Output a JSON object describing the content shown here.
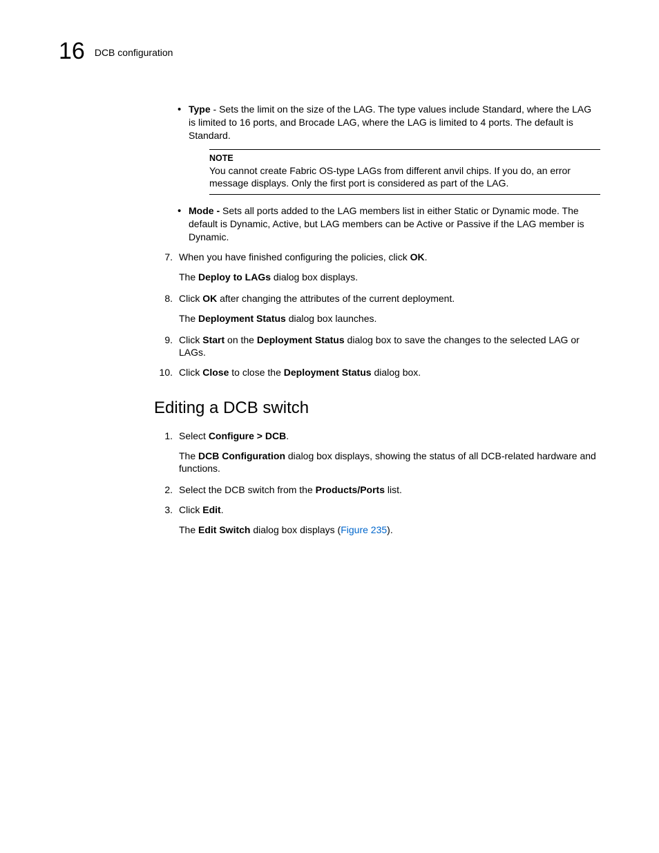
{
  "header": {
    "chapter_number": "16",
    "section_title": "DCB configuration"
  },
  "bullets": {
    "type": {
      "label": "Type",
      "text": " - Sets the limit on the size of the LAG. The type values include Standard, where the LAG is limited to 16 ports, and Brocade LAG, where the LAG is limited to 4 ports. The default is Standard."
    },
    "note": {
      "label": "NOTE",
      "text": "You cannot create Fabric OS-type LAGs from different anvil chips. If you do, an error message displays. Only the first port is considered as part of the LAG."
    },
    "mode": {
      "label": "Mode - ",
      "text": "Sets all ports added to the LAG members list in either Static or Dynamic mode. The default is Dynamic, Active, but LAG members can be Active or Passive if the LAG member is Dynamic."
    }
  },
  "steps_a": {
    "s7": {
      "num": "7.",
      "pre": "When you have finished configuring the policies, click ",
      "bold": "OK",
      "post": ".",
      "sub_pre": "The ",
      "sub_bold": "Deploy to LAGs",
      "sub_post": " dialog box displays."
    },
    "s8": {
      "num": "8.",
      "pre": "Click ",
      "bold": "OK",
      "post": " after changing the attributes of the current deployment.",
      "sub_pre": "The ",
      "sub_bold": "Deployment Status",
      "sub_post": " dialog box launches."
    },
    "s9": {
      "num": "9.",
      "pre": "Click ",
      "bold1": "Start",
      "mid": " on the ",
      "bold2": "Deployment Status",
      "post": " dialog box to save the changes to the selected LAG or LAGs."
    },
    "s10": {
      "num": "10.",
      "pre": "Click ",
      "bold1": "Close",
      "mid": " to close the ",
      "bold2": "Deployment Status",
      "post": " dialog box."
    }
  },
  "h2": "Editing a DCB switch",
  "steps_b": {
    "s1": {
      "num": "1.",
      "pre": "Select ",
      "bold": "Configure > DCB",
      "post": ".",
      "sub_pre": "The ",
      "sub_bold": "DCB Configuration",
      "sub_post": " dialog box displays, showing the status of all DCB-related hardware and functions."
    },
    "s2": {
      "num": "2.",
      "pre": "Select the DCB switch from the ",
      "bold": "Products/Ports",
      "post": " list."
    },
    "s3": {
      "num": "3.",
      "pre": "Click ",
      "bold": "Edit",
      "post": ".",
      "sub_pre": "The ",
      "sub_bold": "Edit Switch",
      "sub_mid": " dialog box displays (",
      "sub_link": "Figure 235",
      "sub_post": ")."
    }
  }
}
